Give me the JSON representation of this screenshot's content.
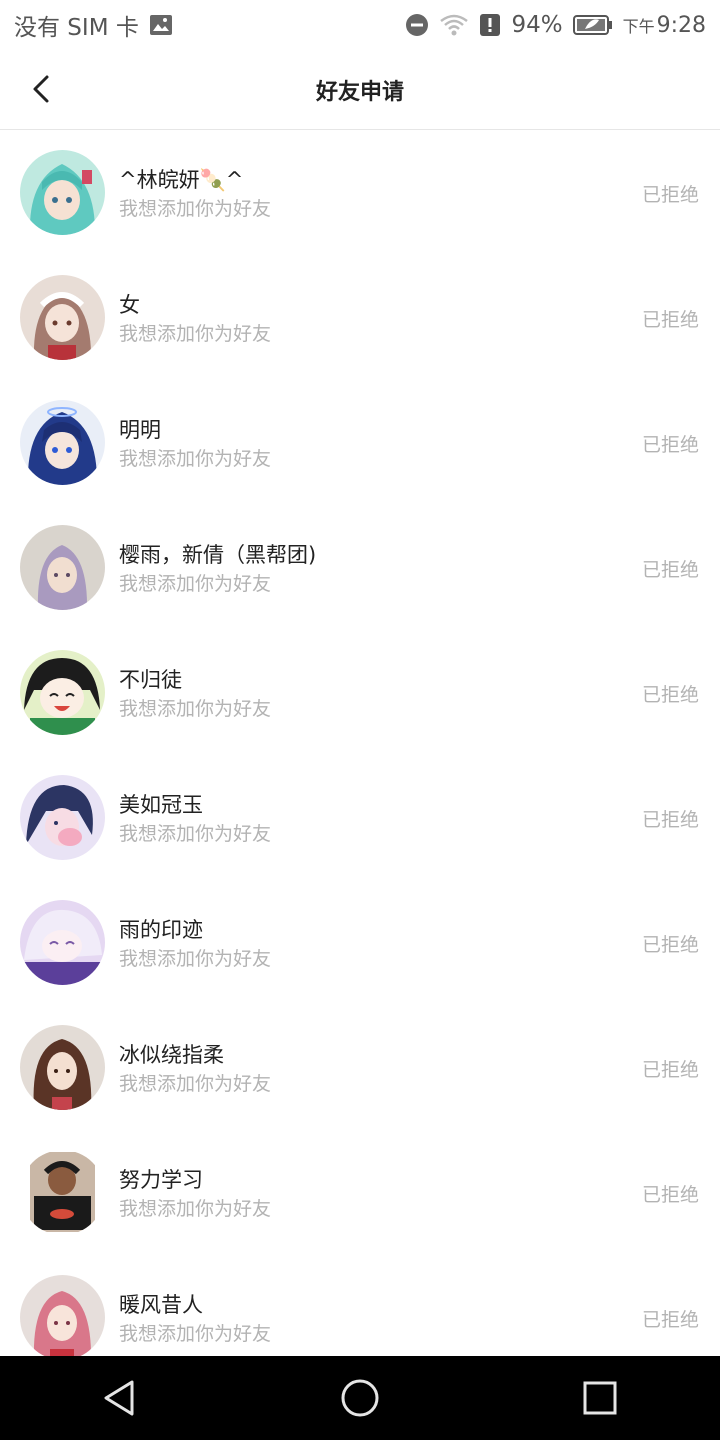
{
  "status_bar": {
    "carrier": "没有 SIM 卡",
    "battery": "94%",
    "ampm": "下午",
    "time": "9:28"
  },
  "header": {
    "title": "好友申请"
  },
  "requests": [
    {
      "name": "^林皖妍🍡^",
      "message": "我想添加你为好友",
      "status": "已拒绝"
    },
    {
      "name": "女",
      "message": "我想添加你为好友",
      "status": "已拒绝"
    },
    {
      "name": "明明",
      "message": "我想添加你为好友",
      "status": "已拒绝"
    },
    {
      "name": "樱雨，新倩（黑帮团)",
      "message": "我想添加你为好友",
      "status": "已拒绝"
    },
    {
      "name": "不归徒",
      "message": "我想添加你为好友",
      "status": "已拒绝"
    },
    {
      "name": "美如冠玉",
      "message": "我想添加你为好友",
      "status": "已拒绝"
    },
    {
      "name": "雨的印迹",
      "message": "我想添加你为好友",
      "status": "已拒绝"
    },
    {
      "name": "冰似绕指柔",
      "message": "我想添加你为好友",
      "status": "已拒绝"
    },
    {
      "name": "努力学习",
      "message": "我想添加你为好友",
      "status": "已拒绝"
    },
    {
      "name": "暖风昔人",
      "message": "我想添加你为好友",
      "status": "已拒绝"
    }
  ],
  "colors": {
    "text_primary": "#222222",
    "text_secondary": "#b3b3b3",
    "divider": "#e6e6e6",
    "nav_background": "#000000"
  }
}
